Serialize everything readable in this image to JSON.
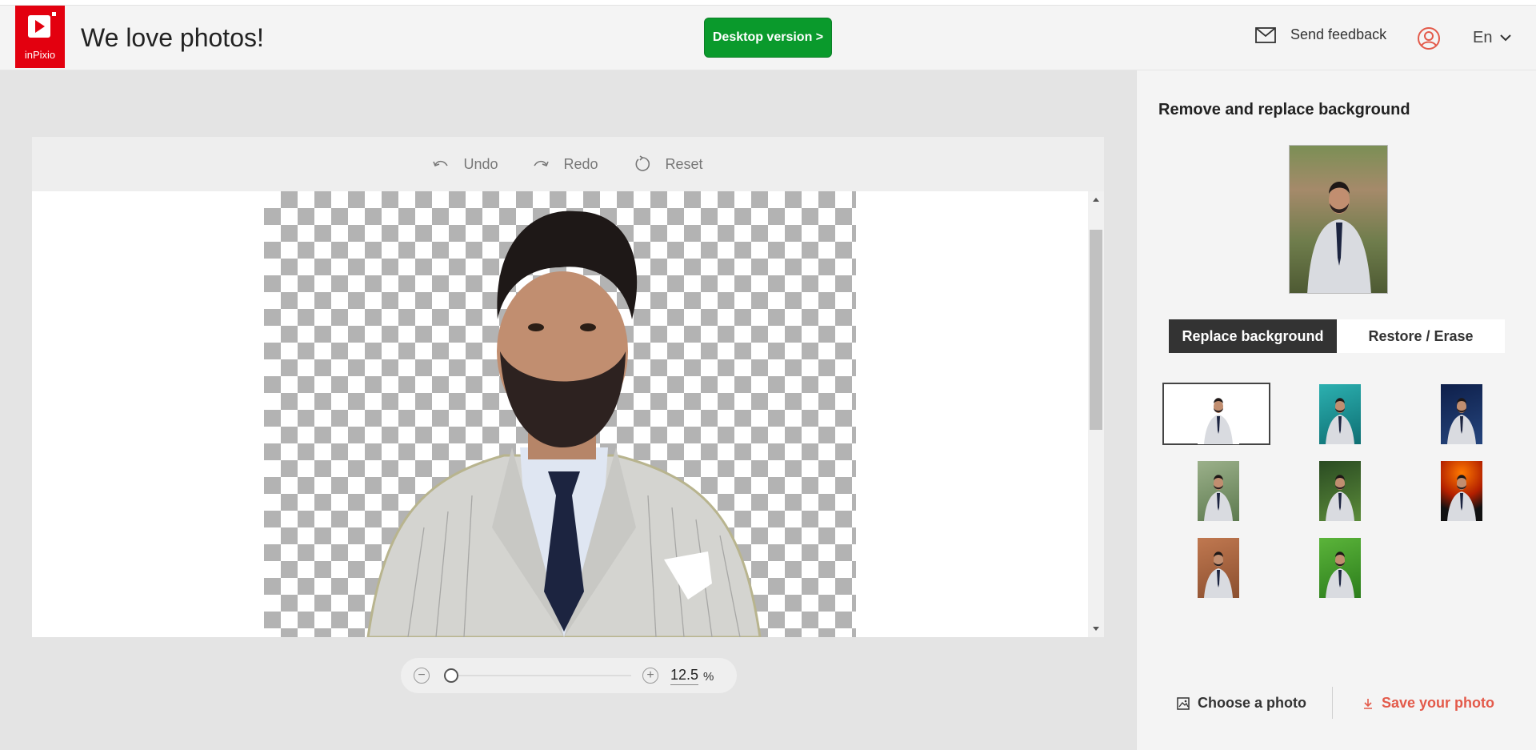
{
  "header": {
    "logo_text": "inPixio",
    "title": "We love photos!",
    "desktop_button": "Desktop version >",
    "feedback_label": "Send feedback",
    "language": "En",
    "brand_color": "#e3000f",
    "cta_color": "#0a9a2c"
  },
  "editor": {
    "toolbar": {
      "undo": "Undo",
      "redo": "Redo",
      "reset": "Reset"
    },
    "zoom": {
      "minus": "−",
      "plus": "+",
      "value": "12.5",
      "unit": "%",
      "slider_level": 0.0
    }
  },
  "panel": {
    "title": "Remove and replace background",
    "tabs": {
      "replace": "Replace background",
      "restore": "Restore / Erase",
      "active": "replace"
    },
    "backgrounds": [
      {
        "name": "white",
        "selected": true
      },
      {
        "name": "teal"
      },
      {
        "name": "night-sky"
      },
      {
        "name": "garden"
      },
      {
        "name": "jungle"
      },
      {
        "name": "fire"
      },
      {
        "name": "brick-wall"
      },
      {
        "name": "green-leaves"
      }
    ],
    "choose_photo": "Choose a photo",
    "save_photo": "Save your photo",
    "save_color": "#e35a4a"
  }
}
